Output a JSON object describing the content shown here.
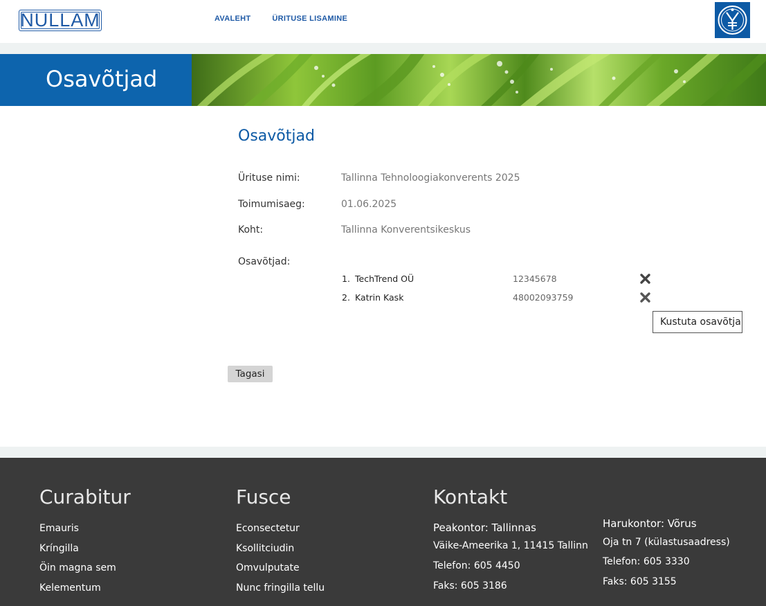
{
  "header": {
    "logo_text": "NULLAM",
    "nav": [
      {
        "label": "AVALEHT"
      },
      {
        "label": "ÜRITUSE LISAMINE"
      }
    ],
    "emblem_icon": "coat-of-arms-icon"
  },
  "banner": {
    "title": "Osavõtjad",
    "image": "grass-with-dew-drops-image"
  },
  "main": {
    "title": "Osavõtjad",
    "fields": [
      {
        "label": "Ürituse nimi:",
        "value": "Tallinna Tehnoloogiakonverents 2025"
      },
      {
        "label": "Toimumisaeg:",
        "value": "01.06.2025"
      },
      {
        "label": "Koht:",
        "value": "Tallinna Konverentsikeskus"
      }
    ],
    "participants_label": "Osavõtjad:",
    "participants": [
      {
        "num": "1.",
        "name": "TechTrend OÜ",
        "code": "12345678"
      },
      {
        "num": "2.",
        "name": "Katrin Kask",
        "code": "48002093759"
      }
    ],
    "delete_icon": "x-icon",
    "tooltip": "Kustuta osavõtja",
    "back_button": "Tagasi"
  },
  "footer": {
    "col1": {
      "heading": "Curabitur",
      "links": [
        "Emauris",
        "Kríngilla",
        "Öin magna sem",
        "Kelementum"
      ]
    },
    "col2": {
      "heading": "Fusce",
      "links": [
        "Econsectetur",
        "Ksollitciudin",
        "Omvulputate",
        "Nunc fringilla tellu"
      ]
    },
    "col3": {
      "heading": "Kontakt",
      "lines": [
        "Peakontor: Tallinnas",
        "Väike-Ameerika 1, 11415 Tallinn",
        "Telefon: 605 4450",
        "Faks: 605 3186"
      ]
    },
    "col4": {
      "lines": [
        "Harukontor: Võrus",
        "Oja tn 7 (külastusaadress)",
        "Telefon: 605 3330",
        "Faks: 605 3155"
      ]
    }
  },
  "colors": {
    "brand_blue": "#0d64ad",
    "footer_bg": "#3a3a3a"
  }
}
